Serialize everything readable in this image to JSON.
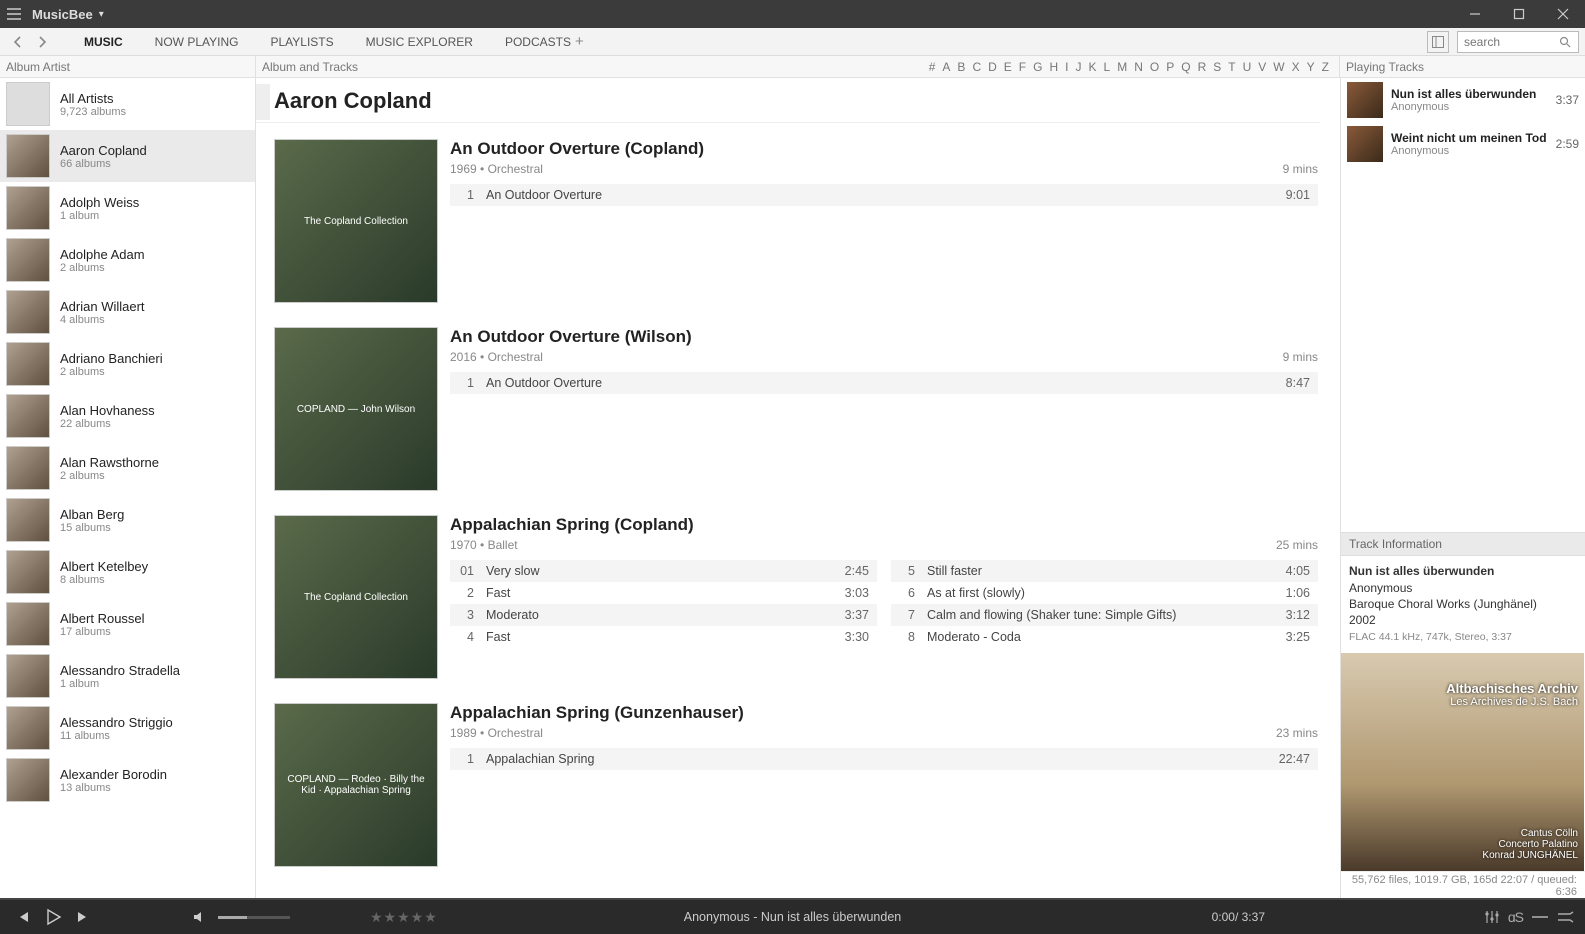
{
  "app": {
    "name": "MusicBee"
  },
  "nav": {
    "tabs": [
      "MUSIC",
      "NOW PLAYING",
      "PLAYLISTS",
      "MUSIC EXPLORER",
      "PODCASTS"
    ],
    "active": 0
  },
  "search": {
    "placeholder": "search"
  },
  "headers": {
    "artist": "Album Artist",
    "album": "Album and Tracks",
    "playing": "Playing Tracks"
  },
  "alphabet": [
    "#",
    "A",
    "B",
    "C",
    "D",
    "E",
    "F",
    "G",
    "H",
    "I",
    "J",
    "K",
    "L",
    "M",
    "N",
    "O",
    "P",
    "Q",
    "R",
    "S",
    "T",
    "U",
    "V",
    "W",
    "X",
    "Y",
    "Z"
  ],
  "artists": [
    {
      "name": "All Artists",
      "sub": "9,723 albums",
      "grey": true
    },
    {
      "name": "Aaron Copland",
      "sub": "66 albums",
      "selected": true
    },
    {
      "name": "Adolph Weiss",
      "sub": "1 album"
    },
    {
      "name": "Adolphe Adam",
      "sub": "2 albums"
    },
    {
      "name": "Adrian Willaert",
      "sub": "4 albums"
    },
    {
      "name": "Adriano Banchieri",
      "sub": "2 albums"
    },
    {
      "name": "Alan Hovhaness",
      "sub": "22 albums"
    },
    {
      "name": "Alan Rawsthorne",
      "sub": "2 albums"
    },
    {
      "name": "Alban Berg",
      "sub": "15 albums"
    },
    {
      "name": "Albert Ketelbey",
      "sub": "8 albums"
    },
    {
      "name": "Albert Roussel",
      "sub": "17 albums"
    },
    {
      "name": "Alessandro Stradella",
      "sub": "1 album"
    },
    {
      "name": "Alessandro Striggio",
      "sub": "11 albums"
    },
    {
      "name": "Alexander Borodin",
      "sub": "13 albums"
    }
  ],
  "page": {
    "title": "Aaron Copland"
  },
  "albums": [
    {
      "title": "An Outdoor Overture (Copland)",
      "year": "1969",
      "genre": "Orchestral",
      "duration": "9 mins",
      "cover_text": "The Copland Collection",
      "tracks_left": [
        {
          "n": "1",
          "t": "An Outdoor Overture",
          "d": "9:01"
        }
      ],
      "tracks_right": []
    },
    {
      "title": "An Outdoor Overture (Wilson)",
      "year": "2016",
      "genre": "Orchestral",
      "duration": "9 mins",
      "cover_text": "COPLAND — John Wilson",
      "tracks_left": [
        {
          "n": "1",
          "t": "An Outdoor Overture",
          "d": "8:47"
        }
      ],
      "tracks_right": []
    },
    {
      "title": "Appalachian Spring (Copland)",
      "year": "1970",
      "genre": "Ballet",
      "duration": "25 mins",
      "cover_text": "The Copland Collection",
      "tracks_left": [
        {
          "n": "01",
          "t": "Very slow",
          "d": "2:45"
        },
        {
          "n": "2",
          "t": "Fast",
          "d": "3:03"
        },
        {
          "n": "3",
          "t": "Moderato",
          "d": "3:37"
        },
        {
          "n": "4",
          "t": "Fast",
          "d": "3:30"
        }
      ],
      "tracks_right": [
        {
          "n": "5",
          "t": "Still faster",
          "d": "4:05"
        },
        {
          "n": "6",
          "t": "As at first (slowly)",
          "d": "1:06"
        },
        {
          "n": "7",
          "t": "Calm and flowing (Shaker tune: Simple Gifts)",
          "d": "3:12"
        },
        {
          "n": "8",
          "t": "Moderato - Coda",
          "d": "3:25"
        }
      ]
    },
    {
      "title": "Appalachian Spring (Gunzenhauser)",
      "year": "1989",
      "genre": "Orchestral",
      "duration": "23 mins",
      "cover_text": "COPLAND — Rodeo · Billy the Kid · Appalachian Spring",
      "tracks_left": [
        {
          "n": "1",
          "t": "Appalachian Spring",
          "d": "22:47"
        }
      ],
      "tracks_right": []
    }
  ],
  "playing_tracks": [
    {
      "title": "Nun ist alles überwunden",
      "artist": "Anonymous",
      "dur": "3:37"
    },
    {
      "title": "Weint nicht um meinen Tod",
      "artist": "Anonymous",
      "dur": "2:59"
    }
  ],
  "track_info": {
    "header": "Track Information",
    "title": "Nun ist alles überwunden",
    "artist": "Anonymous",
    "album": "Baroque Choral Works (Junghänel)",
    "year": "2002",
    "tech": "FLAC 44.1 kHz, 747k, Stereo, 3:37",
    "art_line1": "Altbachisches Archiv",
    "art_line2": "Les Archives de J.S. Bach",
    "art_line3": "Cantus Cölln",
    "art_line4": "Concerto Palatino",
    "art_line5": "Konrad JUNGHÄNEL"
  },
  "stats": "55,762 files, 1019.7 GB, 165d 22:07  /   queued: 6:36",
  "player": {
    "nowplaying": "Anonymous - Nun ist alles überwunden",
    "time": "0:00/ 3:37"
  }
}
